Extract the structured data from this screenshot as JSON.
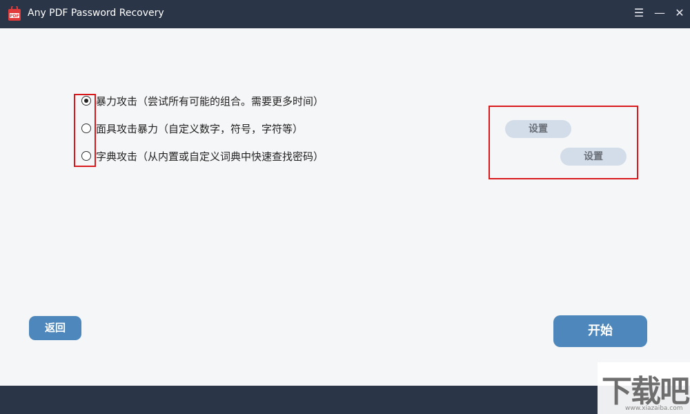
{
  "window": {
    "title": "Any PDF Password Recovery",
    "icon_label": "PDF",
    "menu_glyph": "☰",
    "minimize_glyph": "—",
    "close_glyph": "✕"
  },
  "attack_options": [
    {
      "label": "暴力攻击（尝试所有可能的组合。需要更多时间）",
      "selected": true
    },
    {
      "label": "面具攻击暴力（自定义数字，符号，字符等）",
      "selected": false
    },
    {
      "label": "字典攻击（从内置或自定义词典中快速查找密码）",
      "selected": false
    }
  ],
  "settings_buttons": {
    "mask_settings_label": "设置",
    "dictionary_settings_label": "设置"
  },
  "actions": {
    "back_label": "返回",
    "start_label": "开始"
  },
  "watermark": {
    "main": "下载吧",
    "sub": "www.xiazaiba.com"
  },
  "colors": {
    "titlebar": "#2b3548",
    "primary_button": "#4d87bb",
    "settings_button": "#d3dde9",
    "highlight_border": "#d9181c"
  }
}
